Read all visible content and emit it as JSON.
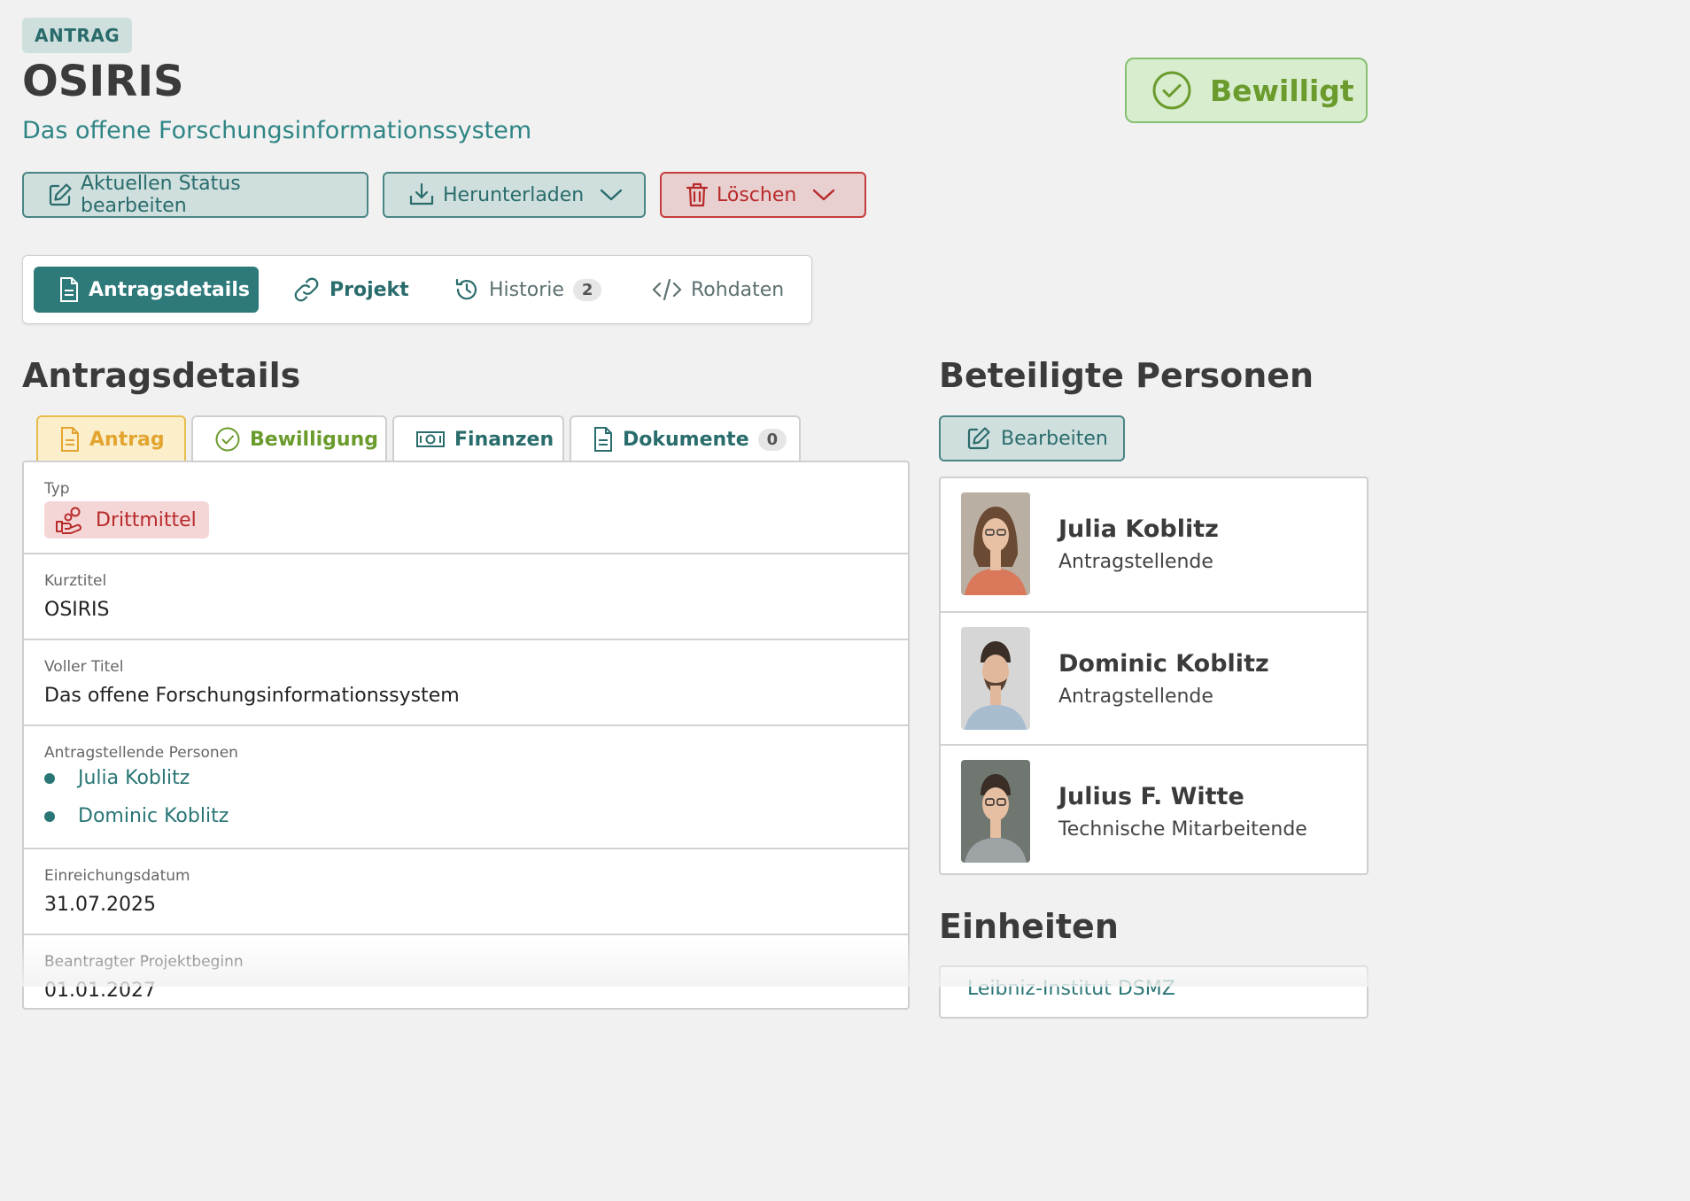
{
  "header": {
    "type_label": "ANTRAG",
    "title": "OSIRIS",
    "subtitle": "Das offene Forschungsinformationssystem",
    "status_label": "Bewilligt",
    "colors": {
      "accent": "#2e7a7a",
      "status_green": "#6a9b2c",
      "danger": "#b82a2a"
    }
  },
  "actions": {
    "edit_status": "Aktuellen Status bearbeiten",
    "download": "Herunterladen",
    "delete": "Löschen"
  },
  "tabs": [
    {
      "label": "Antragsdetails",
      "icon": "file-icon",
      "active": true
    },
    {
      "label": "Projekt",
      "icon": "link-icon"
    },
    {
      "label": "Historie",
      "icon": "history-icon",
      "count": "2"
    },
    {
      "label": "Rohdaten",
      "icon": "code-icon"
    }
  ],
  "details": {
    "heading": "Antragsdetails",
    "subtabs": [
      {
        "label": "Antrag",
        "icon": "file-icon",
        "active": true
      },
      {
        "label": "Bewilligung",
        "icon": "check-circle-icon"
      },
      {
        "label": "Finanzen",
        "icon": "banknote-icon"
      },
      {
        "label": "Dokumente",
        "icon": "document-icon",
        "count": "0"
      }
    ],
    "fields": {
      "type": {
        "label": "Typ",
        "value": "Drittmittel"
      },
      "short_title": {
        "label": "Kurztitel",
        "value": "OSIRIS"
      },
      "full_title": {
        "label": "Voller Titel",
        "value": "Das offene Forschungsinformationssystem"
      },
      "applicants": {
        "label": "Antragstellende Personen",
        "values": [
          "Julia Koblitz",
          "Dominic Koblitz"
        ]
      },
      "submission_date": {
        "label": "Einreichungsdatum",
        "value": "31.07.2025"
      },
      "project_start": {
        "label": "Beantragter Projektbeginn",
        "value": "01.01.2027"
      }
    }
  },
  "people": {
    "heading": "Beteiligte Personen",
    "edit_label": "Bearbeiten",
    "list": [
      {
        "name": "Julia Koblitz",
        "role": "Antragstellende"
      },
      {
        "name": "Dominic Koblitz",
        "role": "Antragstellende"
      },
      {
        "name": "Julius F. Witte",
        "role": "Technische Mitarbeitende"
      }
    ]
  },
  "units": {
    "heading": "Einheiten",
    "first_item": "Leibniz-Institut DSMZ"
  }
}
